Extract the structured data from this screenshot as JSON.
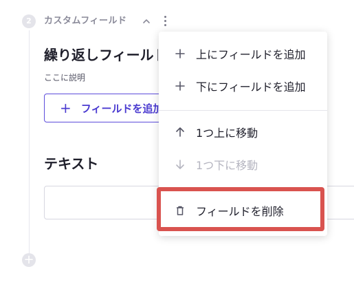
{
  "section": {
    "step_number": "2",
    "title": "カスタムフィールド"
  },
  "field": {
    "title": "繰り返しフィールド",
    "description": "ここに説明",
    "add_button_label": "フィールドを追加"
  },
  "text_field": {
    "label": "テキスト",
    "value": ""
  },
  "menu": {
    "items": [
      {
        "label": "上にフィールドを追加",
        "icon": "plus-icon",
        "disabled": false
      },
      {
        "label": "下にフィールドを追加",
        "icon": "plus-icon",
        "disabled": false
      },
      {
        "label": "1つ上に移動",
        "icon": "arrow-up-icon",
        "disabled": false
      },
      {
        "label": "1つ下に移動",
        "icon": "arrow-down-icon",
        "disabled": true
      },
      {
        "label": "フィールドを削除",
        "icon": "trash-icon",
        "disabled": false
      }
    ]
  },
  "colors": {
    "accent": "#5b4bdb",
    "highlight": "#d9534f",
    "muted": "#8a8a99"
  }
}
